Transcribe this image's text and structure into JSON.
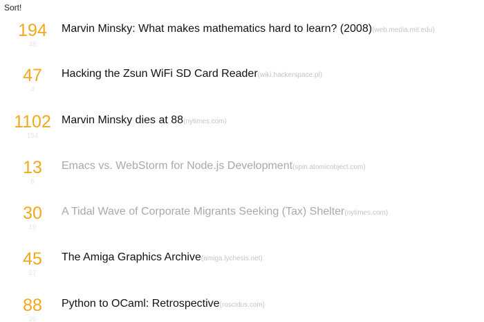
{
  "header": {
    "sort_label": "Sort!"
  },
  "stories": [
    {
      "score": "194",
      "comments": "48",
      "title": "Marvin Minsky: What makes mathematics hard to learn? (2008)",
      "domain": "(web.media.mit.edu)",
      "visited": false
    },
    {
      "score": "47",
      "comments": "4",
      "title": "Hacking the Zsun WiFi SD Card Reader",
      "domain": "(wiki.hackerspace.pl)",
      "visited": false
    },
    {
      "score": "1102",
      "comments": "154",
      "title": "Marvin Minsky dies at 88",
      "domain": "(nytimes.com)",
      "visited": false
    },
    {
      "score": "13",
      "comments": "6",
      "title": "Emacs vs. WebStorm for Node.js Development",
      "domain": "(spin.atomicobject.com)",
      "visited": true
    },
    {
      "score": "30",
      "comments": "19",
      "title": "A Tidal Wave of Corporate Migrants Seeking (Tax) Shelter",
      "domain": "(nytimes.com)",
      "visited": true
    },
    {
      "score": "45",
      "comments": "27",
      "title": "The Amiga Graphics Archive",
      "domain": "(amiga.lychesis.net)",
      "visited": false
    },
    {
      "score": "88",
      "comments": "26",
      "title": "Python to OCaml: Retrospective",
      "domain": "(roscidus.com)",
      "visited": false
    }
  ]
}
